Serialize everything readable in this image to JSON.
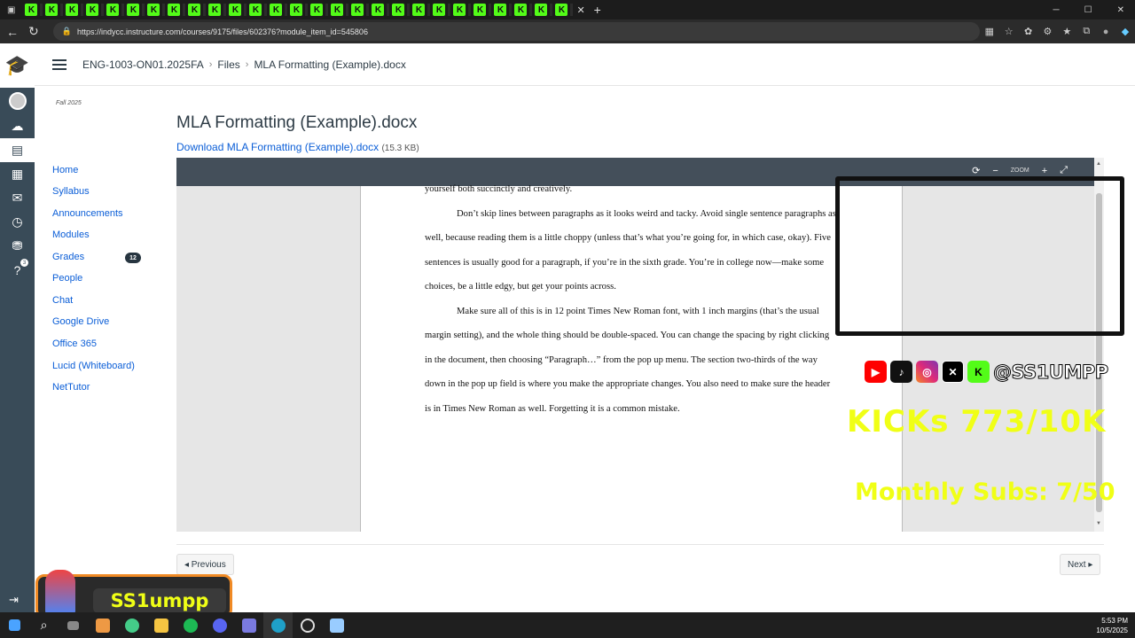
{
  "browser": {
    "url": "https://indycc.instructure.com/courses/9175/files/602376?module_item_id=545806",
    "tab_icon_letter": "K"
  },
  "header": {
    "breadcrumb": [
      "ENG-1003-ON01.2025FA",
      "Files",
      "MLA Formatting (Example).docx"
    ]
  },
  "course_nav": {
    "term": "Fall 2025",
    "items": [
      {
        "label": "Home"
      },
      {
        "label": "Syllabus"
      },
      {
        "label": "Announcements"
      },
      {
        "label": "Modules"
      },
      {
        "label": "Grades",
        "badge": "12"
      },
      {
        "label": "People"
      },
      {
        "label": "Chat"
      },
      {
        "label": "Google Drive"
      },
      {
        "label": "Office 365"
      },
      {
        "label": "Lucid (Whiteboard)"
      },
      {
        "label": "NetTutor"
      }
    ]
  },
  "global_nav": {
    "help_badge": "3"
  },
  "main": {
    "title": "MLA Formatting (Example).docx",
    "download_label": "Download MLA Formatting (Example).docx",
    "file_size": "(15.3 KB)",
    "zoom_label": "ZOOM",
    "doc": {
      "first_line": "yourself both succinctly and creatively.",
      "para1": "Don’t skip lines between paragraphs as it looks weird and tacky. Avoid single sentence paragraphs as well, because reading them is a little choppy (unless that’s what you’re going for, in which case, okay). Five sentences is usually good for a paragraph, if you’re in the sixth grade. You’re in college now—make some choices, be a little edgy, but get your points across.",
      "para2": "Make sure all of this is in 12 point Times New Roman font, with 1 inch margins (that’s the usual margin setting), and the whole thing should be double-spaced. You can change the spacing by right clicking in the document, then choosing “Paragraph…” from the pop up menu. The section two-thirds of the way down in the pop up field is where you make the appropriate changes. You also need to make sure the header is in Times New Roman as well. Forgetting it is a common mistake."
    },
    "previous_label": "◂ Previous",
    "next_label": "Next ▸"
  },
  "overlay": {
    "handle": "@SS1UMPP",
    "kicks": "KICKs 773/10K",
    "subs": "Monthly Subs: 7/50",
    "streamer": "SS1umpp"
  },
  "taskbar": {
    "time": "5:53 PM",
    "date": "10/5/2025"
  },
  "colors": {
    "canvas_nav": "#394b58",
    "kick_green": "#53fc18",
    "overlay_yellow": "#f0ff16",
    "link_blue": "#0b5ed7"
  }
}
